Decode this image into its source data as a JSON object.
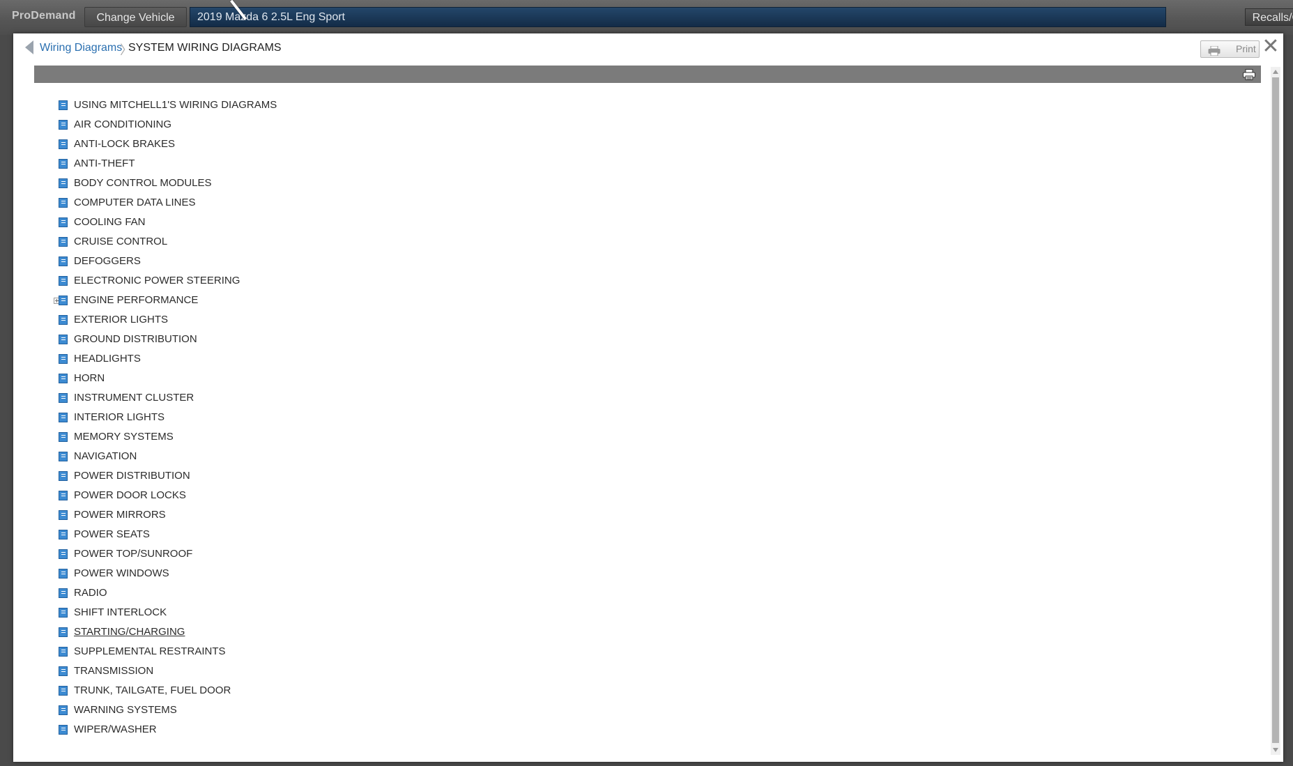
{
  "app": {
    "brand": "ProDemand",
    "change_vehicle_label": "Change Vehicle",
    "vehicle": "2019 Mazda 6 2.5L Eng Sport",
    "recalls_label": "Recalls/Campaigns"
  },
  "breadcrumb": {
    "parent": "Wiring Diagrams",
    "separator": "〉",
    "current": "SYSTEM WIRING DIAGRAMS"
  },
  "toolbar": {
    "print_label": "Print",
    "close_glyph": "✕"
  },
  "icons": {
    "item": "book-icon",
    "expand": "plus-square-icon",
    "print": "printer-icon"
  },
  "colors": {
    "vehicle_bar": "#1c3a5a",
    "link": "#2a6fb0",
    "book_icon": "#3d8bd2"
  },
  "items": [
    {
      "label": "USING MITCHELL1'S WIRING DIAGRAMS"
    },
    {
      "label": "AIR CONDITIONING"
    },
    {
      "label": "ANTI-LOCK BRAKES"
    },
    {
      "label": "ANTI-THEFT"
    },
    {
      "label": "BODY CONTROL MODULES"
    },
    {
      "label": "COMPUTER DATA LINES"
    },
    {
      "label": "COOLING FAN"
    },
    {
      "label": "CRUISE CONTROL"
    },
    {
      "label": "DEFOGGERS"
    },
    {
      "label": "ELECTRONIC POWER STEERING"
    },
    {
      "label": "ENGINE PERFORMANCE",
      "expandable": true
    },
    {
      "label": "EXTERIOR LIGHTS"
    },
    {
      "label": "GROUND DISTRIBUTION"
    },
    {
      "label": "HEADLIGHTS"
    },
    {
      "label": "HORN"
    },
    {
      "label": "INSTRUMENT CLUSTER"
    },
    {
      "label": "INTERIOR LIGHTS"
    },
    {
      "label": "MEMORY SYSTEMS"
    },
    {
      "label": "NAVIGATION"
    },
    {
      "label": "POWER DISTRIBUTION"
    },
    {
      "label": "POWER DOOR LOCKS"
    },
    {
      "label": "POWER MIRRORS"
    },
    {
      "label": "POWER SEATS"
    },
    {
      "label": "POWER TOP/SUNROOF"
    },
    {
      "label": "POWER WINDOWS"
    },
    {
      "label": "RADIO"
    },
    {
      "label": "SHIFT INTERLOCK"
    },
    {
      "label": "STARTING/CHARGING",
      "hovered": true
    },
    {
      "label": "SUPPLEMENTAL RESTRAINTS"
    },
    {
      "label": "TRANSMISSION"
    },
    {
      "label": "TRUNK, TAILGATE, FUEL DOOR"
    },
    {
      "label": "WARNING SYSTEMS"
    },
    {
      "label": "WIPER/WASHER"
    }
  ]
}
